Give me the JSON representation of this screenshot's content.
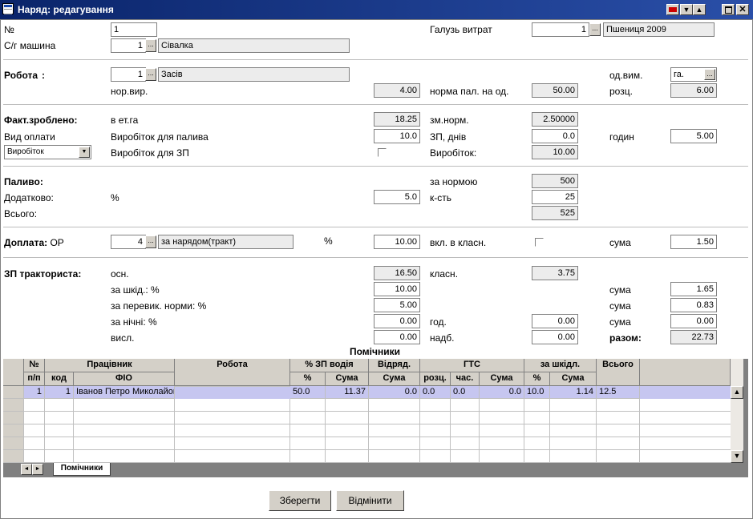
{
  "window": {
    "title": "Наряд: редагування",
    "icon": "document-icon"
  },
  "header": {
    "no_label": "№",
    "no_value": "1",
    "machine_label": "С/г машина",
    "machine_code": "1",
    "machine_name": "Сівалка",
    "cost_label": "Галузь витрат",
    "cost_code": "1",
    "cost_name": "Пшениця 2009"
  },
  "work": {
    "label": "Робота",
    "code": "1",
    "name": "Засів",
    "unit_label": "од.вим.",
    "unit_value": "га.",
    "norm_label": "нор.вир.",
    "norm_value": "4.00",
    "fuel_norm_label": "норма пал. на од.",
    "fuel_norm_value": "50.00",
    "rank_label": "розц.",
    "rank_value": "6.00"
  },
  "fact": {
    "label": "Факт.зроблено:",
    "in_label": "в ет.га",
    "in_value": "18.25",
    "shift_label": "зм.норм.",
    "shift_value": "2.50000",
    "pay_type_label": "Вид оплати",
    "pay_type_value": "Виробіток",
    "fuel_output_label": "Виробіток для палива",
    "fuel_output_value": "10.0",
    "days_label": "ЗП, днів",
    "days_value": "0.0",
    "hours_label": "годин",
    "hours_value": "5.00",
    "salary_output_label": "Виробіток для ЗП",
    "output_label": "Виробіток:",
    "output_value": "10.00"
  },
  "fuel": {
    "label": "Паливо:",
    "extra_label": "Додатково:",
    "percent_label": "%",
    "percent_value": "5.0",
    "total_label": "Всього:",
    "by_norm_label": "за нормою",
    "by_norm_value": "500",
    "qty_label": "к-сть",
    "qty_value": "25",
    "total_value": "525"
  },
  "surcharge": {
    "label": "Доплата:",
    "op_label": "ОР",
    "code": "4",
    "name": "за нарядом(тракт)",
    "percent_label": "%",
    "percent_value": "10.00",
    "class_label": "вкл. в класн.",
    "sum_label": "сума",
    "sum_value": "1.50"
  },
  "driver": {
    "label": "ЗП тракториста:",
    "base_label": "осн.",
    "base_value": "16.50",
    "class_label": "класн.",
    "class_value": "3.75",
    "harm_label": "за шкід.: %",
    "harm_value": "10.00",
    "harm_sum_label": "сума",
    "harm_sum": "1.65",
    "over_label": "за перевик. норми: %",
    "over_value": "5.00",
    "over_sum_label": "сума",
    "over_sum": "0.83",
    "night_label": "за нічні: %",
    "night_value": "0.00",
    "hours_label": "год.",
    "hours_value": "0.00",
    "night_sum_label": "сума",
    "night_sum": "0.00",
    "vysl_label": "висл.",
    "vysl_value": "0.00",
    "bonus_label": "надб.",
    "bonus_value": "0.00",
    "total_label": "разом:",
    "total_value": "22.73"
  },
  "helpers": {
    "title": "Помічники",
    "group_headers": [
      "№",
      "Працівник",
      "Робота",
      "% ЗП водія",
      "Відряд.",
      "ГТС",
      "за шкідл.",
      "Всього"
    ],
    "sub_headers": [
      "п/п",
      "код",
      "ФІО",
      "%",
      "Сума",
      "Сума",
      "розц.",
      "час.",
      "Сума",
      "%",
      "Сума"
    ],
    "rows": [
      [
        "1",
        "1",
        "Іванов Петро Миколайович",
        "",
        "50.0",
        "11.37",
        "0.0",
        "0.0",
        "0.0",
        "0.0",
        "10.0",
        "1.14",
        "12.5"
      ]
    ],
    "tab_label": "Помічники"
  },
  "buttons": {
    "save": "Зберегти",
    "cancel": "Відмінити"
  }
}
